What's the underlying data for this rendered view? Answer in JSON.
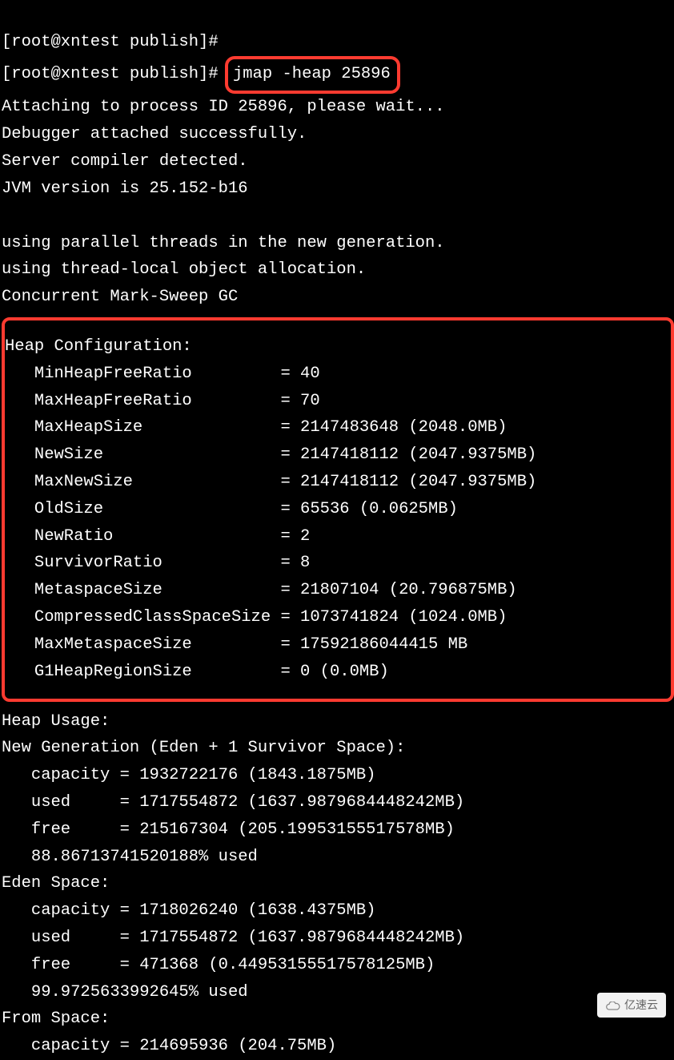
{
  "prompt1": "[root@xntest publish]#",
  "prompt2": "[root@xntest publish]# ",
  "command": "jmap -heap 25896",
  "preamble": [
    "Attaching to process ID 25896, please wait...",
    "Debugger attached successfully.",
    "Server compiler detected.",
    "JVM version is 25.152-b16",
    "",
    "using parallel threads in the new generation.",
    "using thread-local object allocation.",
    "Concurrent Mark-Sweep GC"
  ],
  "heap_config": {
    "header": "Heap Configuration:",
    "lines": [
      "   MinHeapFreeRatio         = 40",
      "   MaxHeapFreeRatio         = 70",
      "   MaxHeapSize              = 2147483648 (2048.0MB)",
      "   NewSize                  = 2147418112 (2047.9375MB)",
      "   MaxNewSize               = 2147418112 (2047.9375MB)",
      "   OldSize                  = 65536 (0.0625MB)",
      "   NewRatio                 = 2",
      "   SurvivorRatio            = 8",
      "   MetaspaceSize            = 21807104 (20.796875MB)",
      "   CompressedClassSpaceSize = 1073741824 (1024.0MB)",
      "   MaxMetaspaceSize         = 17592186044415 MB",
      "   G1HeapRegionSize         = 0 (0.0MB)"
    ]
  },
  "heap_usage": [
    "Heap Usage:",
    "New Generation (Eden + 1 Survivor Space):",
    "   capacity = 1932722176 (1843.1875MB)",
    "   used     = 1717554872 (1637.9879684448242MB)",
    "   free     = 215167304 (205.19953155517578MB)",
    "   88.86713741520188% used",
    "Eden Space:",
    "   capacity = 1718026240 (1638.4375MB)",
    "   used     = 1717554872 (1637.9879684448242MB)",
    "   free     = 471368 (0.44953155517578125MB)",
    "   99.9725633992645% used",
    "From Space:",
    "   capacity = 214695936 (204.75MB)"
  ],
  "watermark": "亿速云"
}
